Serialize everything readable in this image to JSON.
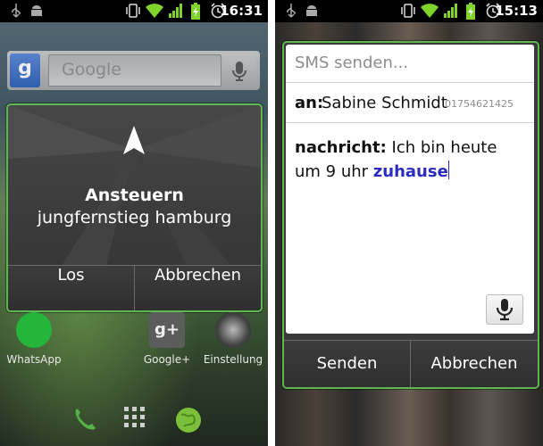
{
  "left_phone": {
    "status": {
      "time": "16:31"
    },
    "search": {
      "logo": "g",
      "placeholder": "Google"
    },
    "dialog": {
      "title": "Ansteuern",
      "destination": "jungfernstieg hamburg",
      "buttons": [
        "Los",
        "Abbrechen"
      ]
    },
    "apps": [
      "WhatsApp",
      "Google+",
      "Einstellung"
    ],
    "colors": {
      "accent": "#5fb84f",
      "whatsapp": "#25b53a"
    }
  },
  "right_phone": {
    "status": {
      "time": "15:13"
    },
    "dialog": {
      "header": "SMS senden...",
      "to_label": "an:",
      "to_name": "Sabine Schmidt",
      "to_number": "01754621425",
      "message_label": "nachricht:",
      "message_text": "Ich bin heute um 9 uhr",
      "message_highlight": "zuhause",
      "buttons": [
        "Senden",
        "Abbrechen"
      ]
    },
    "colors": {
      "highlight": "#2b2bbf"
    }
  },
  "icons": [
    "usb-icon",
    "android-icon",
    "vibrate-icon",
    "wifi-icon",
    "signal-icon",
    "battery-charging-icon",
    "alarm-icon",
    "navigation-arrow-icon",
    "microphone-icon",
    "phone-icon",
    "app-drawer-icon",
    "browser-globe-icon"
  ]
}
